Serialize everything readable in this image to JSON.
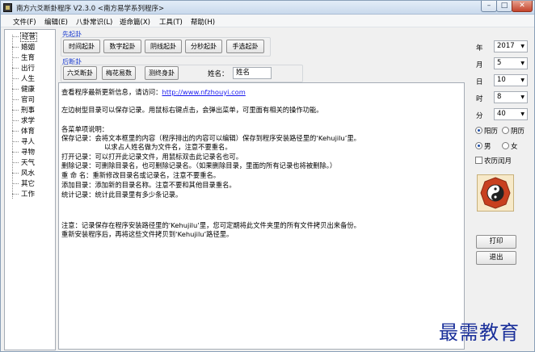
{
  "window": {
    "title": "南方六爻断卦程序 V2.3.0 <南方易学系列程序>"
  },
  "menu": [
    "文件(F)",
    "编辑(E)",
    "八卦常识(L)",
    "遊命篇(X)",
    "工具(T)",
    "帮助(H)"
  ],
  "sidebar": {
    "items": [
      "经营",
      "婚姻",
      "生育",
      "出行",
      "人生",
      "健康",
      "官司",
      "刑事",
      "求学",
      "体育",
      "寻人",
      "寻物",
      "天气",
      "风水",
      "其它",
      "工作"
    ],
    "selected_index": 0
  },
  "divination_start": {
    "label": "先起卦",
    "buttons": [
      "时间起卦",
      "数字起卦",
      "阴线起卦",
      "分秒起卦",
      "手选起卦"
    ]
  },
  "divination_after": {
    "label": "后断卦",
    "buttons": [
      "六爻断卦",
      "梅花易数",
      "测终身卦"
    ],
    "name_label": "姓名：",
    "name_value": "姓名"
  },
  "content": {
    "line1_prefix": "查看程序最新更新信息，请访问：",
    "line1_link": "http://www.nfzhouyi.com",
    "lines": [
      "左边树型目录可以保存记录。用鼠标右键点击，会弹出菜单，可里面有相关的操作功能。",
      "各菜单项说明：",
      "保存记录：会将文本框里的内容（程序排出的内容可以编辑）保存到程序安装路径里的‘Kehujilu’里。",
      "以求占人姓名做为文件名，注意不要重名。",
      "打开记录：可以打开此记录文件，用鼠标双击此记录名也可。",
      "删除记录：可删除目录名，也可删除记录名。（如果删除目录，里面的所有记录也将被删除。）",
      "重 命 名：重新修改目录名或记录名，注意不要重名。",
      "添加目录：添加新的目录名称。注意不要和其他目录重名。",
      "统计记录：统计此目录里有多少条记录。",
      "注意：记录保存在程序安装路径里的‘Kehujilu’里，您可定期将此文件夹里的所有文件拷贝出来备份。",
      "重新安装程序后，再将这些文件拷贝到‘Kehujilu’路径里。"
    ]
  },
  "date": {
    "year_label": "年",
    "year": "2017",
    "month_label": "月",
    "month": "5",
    "day_label": "日",
    "day": "10",
    "hour_label": "时",
    "hour": "8",
    "minute_label": "分",
    "minute": "40"
  },
  "calendar": {
    "solar_label": "阳历",
    "lunar_label": "阴历",
    "selected": "solar",
    "male_label": "男",
    "female_label": "女",
    "gender": "male",
    "leap_label": "农历闰月",
    "leap_checked": false
  },
  "actions": {
    "print": "打印",
    "exit": "退出"
  },
  "watermark": "最需教育",
  "colors": {
    "group_label": "#1f3fd0",
    "link": "#1a1aee",
    "watermark": "#1a2f9a"
  },
  "icons": {
    "bagua": "bagua-yin-yang-icon"
  }
}
